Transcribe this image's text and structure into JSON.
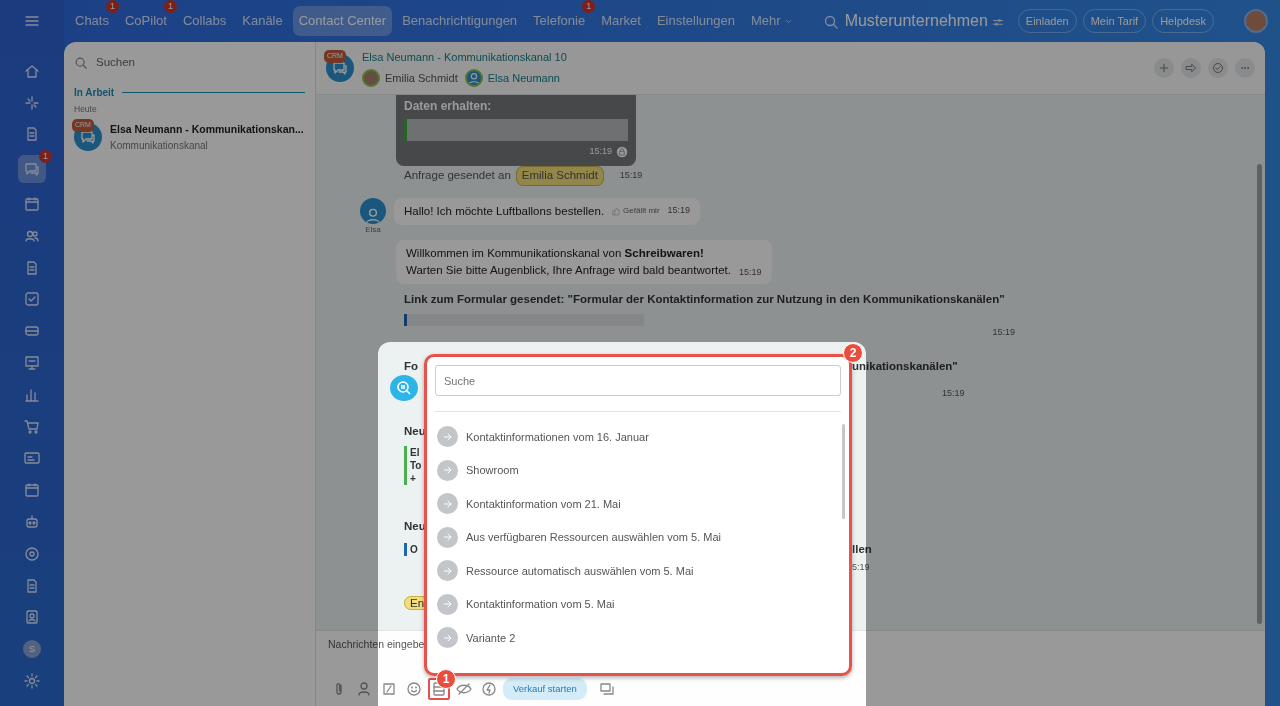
{
  "topbar": {
    "menu_items": [
      {
        "label": "Chats",
        "badge": "1",
        "selected": false
      },
      {
        "label": "CoPilot",
        "badge": "1",
        "selected": false
      },
      {
        "label": "Collabs",
        "selected": false
      },
      {
        "label": "Kanäle",
        "selected": false
      },
      {
        "label": "Contact Center",
        "selected": true
      },
      {
        "label": "Benachrichtigungen",
        "selected": false
      },
      {
        "label": "Telefonie",
        "badge": "1",
        "selected": false
      },
      {
        "label": "Market",
        "selected": false
      },
      {
        "label": "Einstellungen",
        "selected": false
      },
      {
        "label": "Mehr",
        "selected": false
      }
    ],
    "company": "Musterunternehmen",
    "buttons": [
      "Einladen",
      "Mein Tarif",
      "Helpdesk"
    ]
  },
  "rail": {
    "items": [
      {
        "kind": "menu"
      },
      {
        "kind": "house"
      },
      {
        "kind": "sparkle"
      },
      {
        "kind": "document"
      },
      {
        "kind": "chat",
        "badge": "1"
      },
      {
        "kind": "calendar"
      },
      {
        "kind": "people"
      },
      {
        "kind": "document"
      },
      {
        "kind": "checkbox"
      },
      {
        "kind": "drive"
      },
      {
        "kind": "presentation"
      },
      {
        "kind": "bar-chart"
      },
      {
        "kind": "cart"
      },
      {
        "kind": "id-card"
      },
      {
        "kind": "calendar"
      },
      {
        "kind": "robot"
      },
      {
        "kind": "target"
      },
      {
        "kind": "document"
      },
      {
        "kind": "clipboard"
      },
      {
        "kind": "avatar",
        "letter": "S"
      },
      {
        "kind": "gear"
      }
    ]
  },
  "chat_list": {
    "search_placeholder": "Suchen",
    "section": "In Arbeit",
    "date": "Heute",
    "items": [
      {
        "badge": "CRM",
        "title": "Elsa Neumann - Kommunikationskan...",
        "subtitle": "Kommunikationskanal",
        "selected": false
      }
    ]
  },
  "chat": {
    "badge": "CRM",
    "title": "Elsa Neumann - Kommunikationskanal 10",
    "members": [
      {
        "name": "Emilia Schmidt",
        "kind": "employee"
      },
      {
        "name": "Elsa Neumann",
        "kind": "client"
      }
    ],
    "messages": [
      {
        "kind": "data",
        "title": "Daten erhalten:",
        "time": "15:19"
      },
      {
        "kind": "system",
        "text": "Anfrage gesendet an",
        "tag": "Emilia Schmidt",
        "time": "15:19"
      },
      {
        "kind": "incoming",
        "author": "Elsa",
        "text": "Hallo! Ich möchte Luftballons bestellen.",
        "like": "Gefällt mir",
        "time": "15:19"
      },
      {
        "kind": "bot",
        "text": "Willkommen im Kommunikationskanal von **Schreibwaren!**\nWarten Sie bitte Augenblick, Ihre Anfrage wird bald beantwortet.",
        "time": "15:19"
      },
      {
        "kind": "form",
        "title": "Link zum Formular gesendet: \"Formular der Kontaktinformation zur Nutzung in den Kommunikationskanälen\"",
        "time": "15:19"
      }
    ],
    "partly_hidden": [
      {
        "kind": "split",
        "left": "Fo",
        "right": "unikationskanälen\""
      },
      {
        "kind": "time",
        "right": "15:19"
      },
      {
        "kind": "heading",
        "left": "Neu"
      },
      {
        "kind": "quote",
        "color": "#4caf50",
        "lines": [
          "El",
          "To",
          "+"
        ]
      },
      {
        "kind": "heading",
        "left": "Neu"
      },
      {
        "kind": "quote",
        "color": "#2066b0",
        "lines": [
          "O"
        ],
        "right": "llen"
      },
      {
        "kind": "time",
        "right": "5:19"
      },
      {
        "kind": "tag",
        "left": "En"
      }
    ]
  },
  "composer": {
    "placeholder": "Nachrichten eingebe",
    "tools": [
      {
        "kind": "paperclip",
        "highlighted": false
      },
      {
        "kind": "person",
        "highlighted": false
      },
      {
        "kind": "slash-box",
        "highlighted": false
      },
      {
        "kind": "smiley",
        "highlighted": false
      },
      {
        "kind": "list",
        "highlighted": true
      },
      {
        "kind": "eye-slash",
        "highlighted": false
      },
      {
        "kind": "lightning",
        "highlighted": false
      },
      {
        "kind": "pill",
        "label": "Verkauf starten",
        "highlighted": false
      },
      {
        "kind": "windows",
        "highlighted": false
      }
    ]
  },
  "popup": {
    "search_placeholder": "Suche",
    "items": [
      "Kontaktinformationen vom 16. Januar",
      "Showroom",
      "Kontaktinformation vom 21. Mai",
      "Aus verfügbaren Ressourcen auswählen vom 5. Mai",
      "Ressource automatisch auswählen vom 5. Mai",
      "Kontaktinformation vom 5. Mai",
      "Variante 2"
    ]
  },
  "annotations": [
    {
      "number": "1"
    },
    {
      "number": "2"
    }
  ]
}
